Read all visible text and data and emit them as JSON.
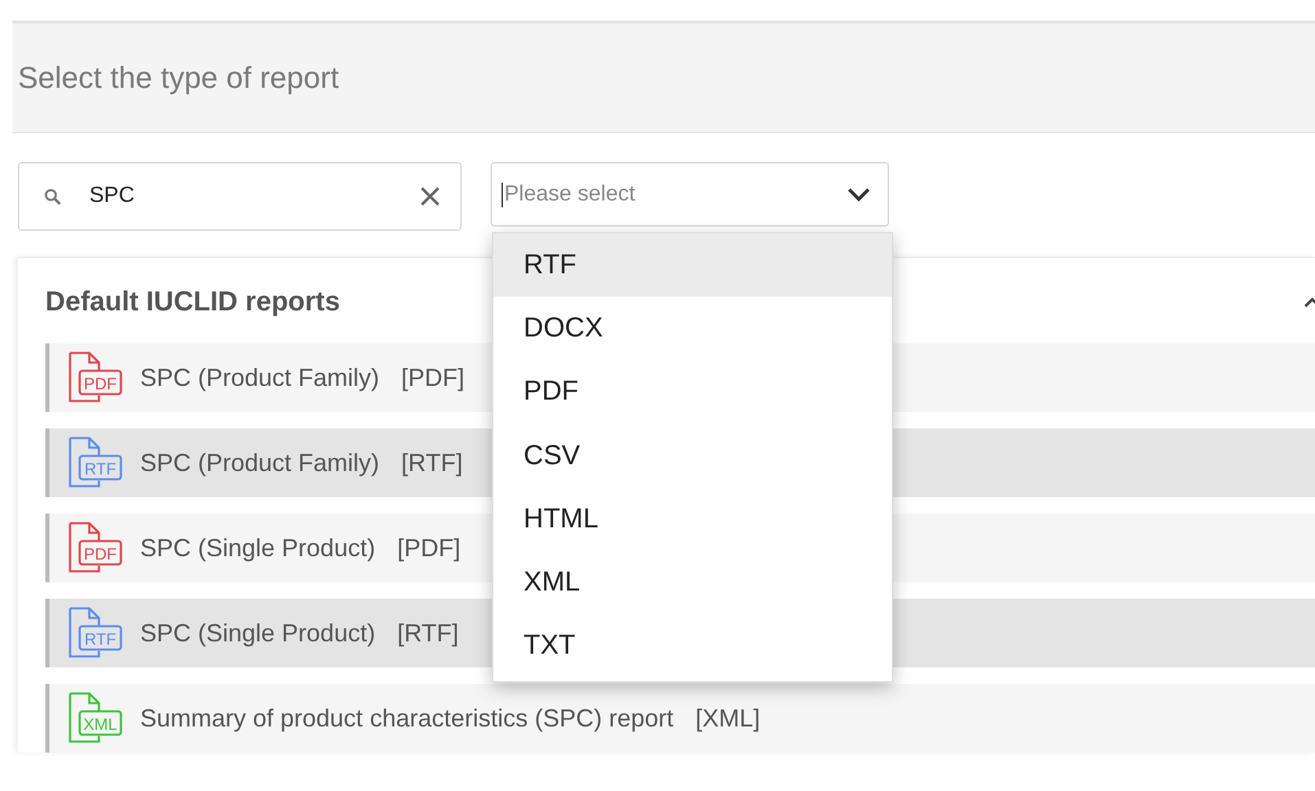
{
  "header": {
    "title": "Select the type of report"
  },
  "search": {
    "value": "SPC"
  },
  "format_select": {
    "placeholder": "Please select",
    "expanded": true,
    "options": [
      {
        "label": "RTF",
        "highlighted": true
      },
      {
        "label": "DOCX",
        "highlighted": false
      },
      {
        "label": "PDF",
        "highlighted": false
      },
      {
        "label": "CSV",
        "highlighted": false
      },
      {
        "label": "HTML",
        "highlighted": false
      },
      {
        "label": "XML",
        "highlighted": false
      },
      {
        "label": "TXT",
        "highlighted": false
      }
    ]
  },
  "section": {
    "title": "Default IUCLID reports",
    "expanded": true,
    "reports": [
      {
        "name": "SPC (Product Family)",
        "format": "[PDF]",
        "kind": "pdf",
        "icon_text": "PDF",
        "shaded": false
      },
      {
        "name": "SPC (Product Family)",
        "format": "[RTF]",
        "kind": "rtf",
        "icon_text": "RTF",
        "shaded": true
      },
      {
        "name": "SPC (Single Product)",
        "format": "[PDF]",
        "kind": "pdf",
        "icon_text": "PDF",
        "shaded": false
      },
      {
        "name": "SPC (Single Product)",
        "format": "[RTF]",
        "kind": "rtf",
        "icon_text": "RTF",
        "shaded": true
      },
      {
        "name": "Summary of product characteristics (SPC) report",
        "format": "[XML]",
        "kind": "xml",
        "icon_text": "XML",
        "shaded": false
      }
    ]
  }
}
